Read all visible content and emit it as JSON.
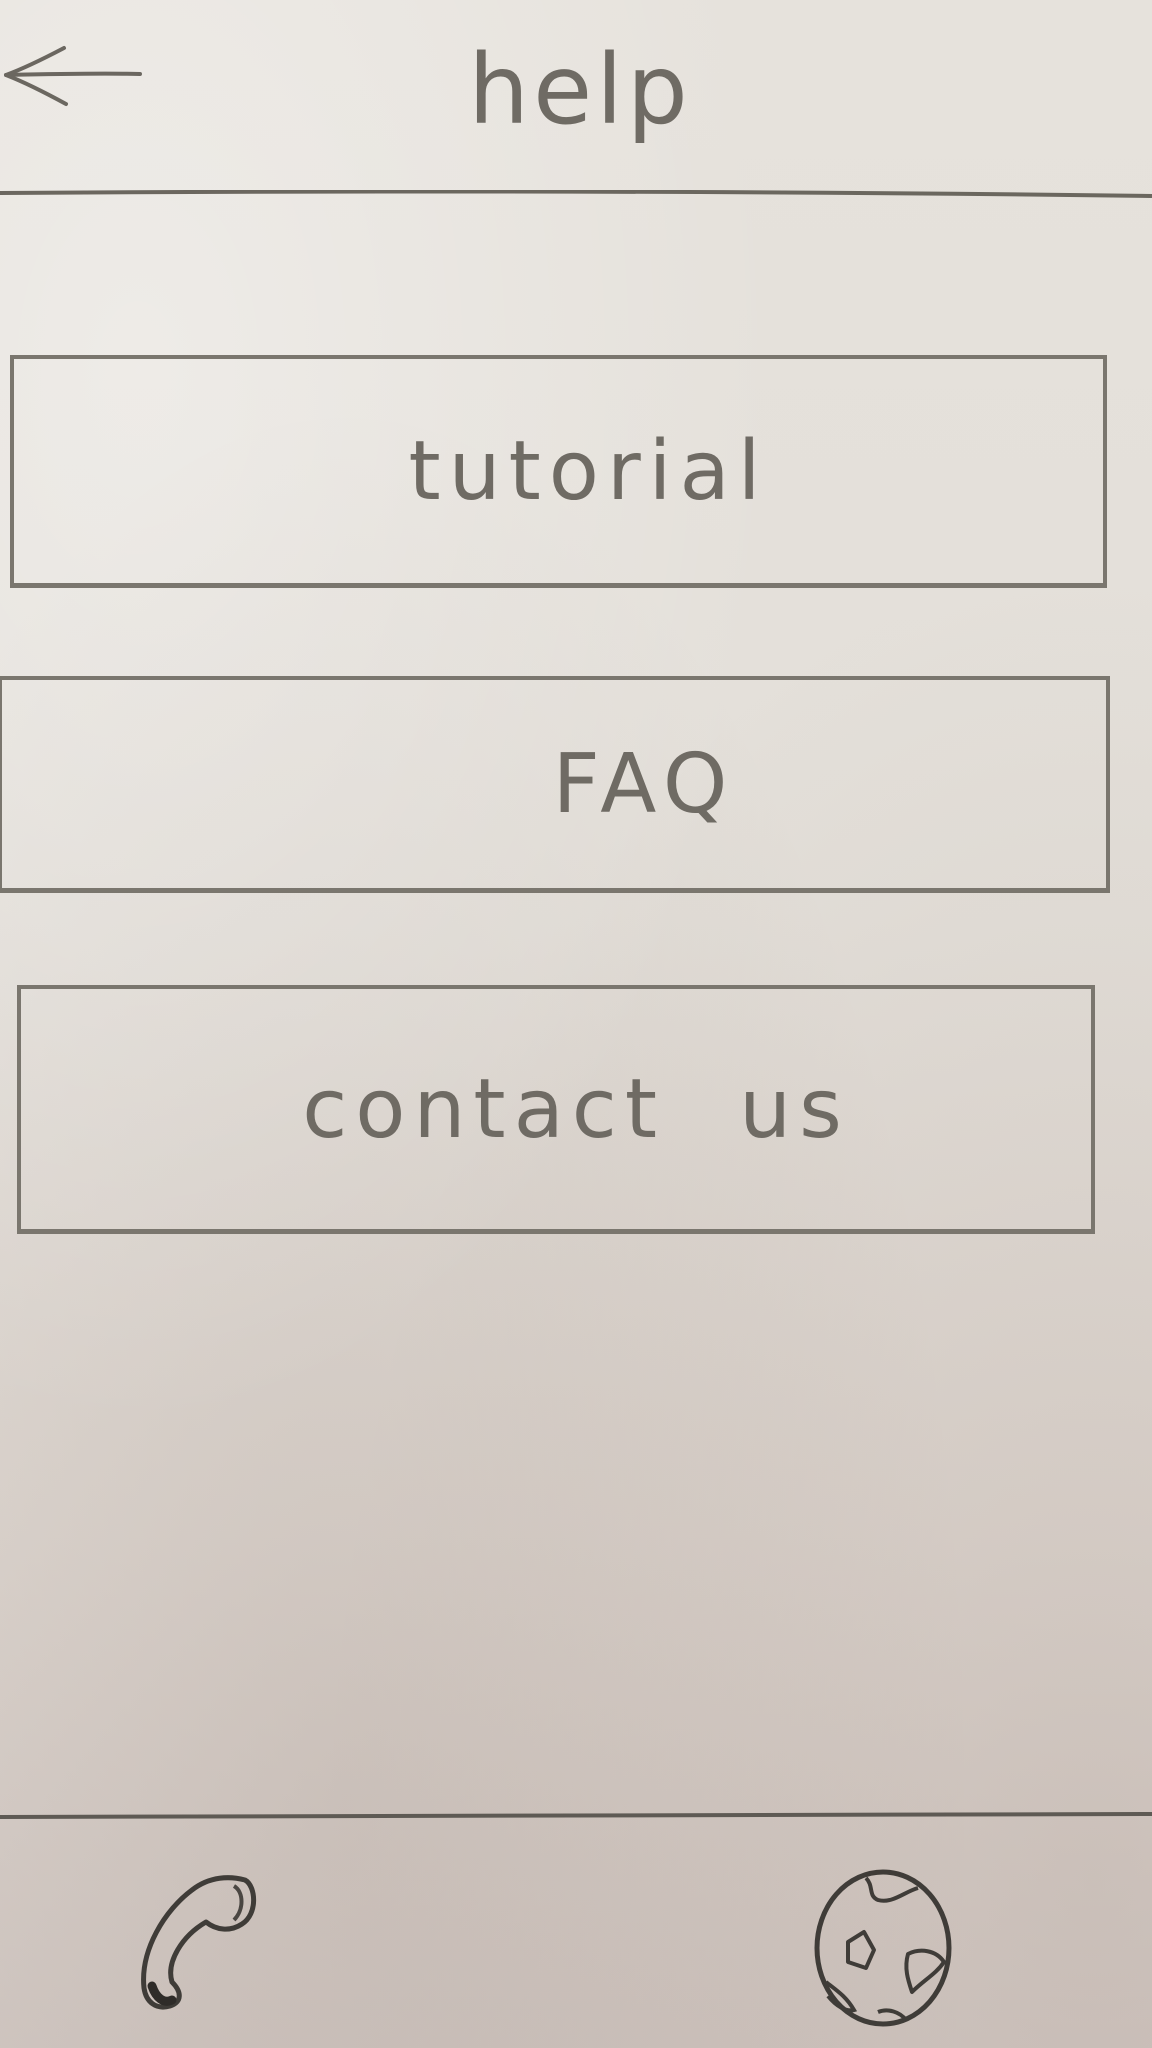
{
  "header": {
    "back_icon": "arrow-left-icon",
    "title": "help"
  },
  "menu": {
    "items": [
      {
        "label": "tutorial"
      },
      {
        "label": "FAQ"
      },
      {
        "label": "contact us"
      }
    ]
  },
  "bottom_bar": {
    "left_icon": "phone-icon",
    "right_icon": "globe-icon"
  },
  "colors": {
    "paper": "#e3dfd9",
    "pencil": "#6f6b64"
  }
}
